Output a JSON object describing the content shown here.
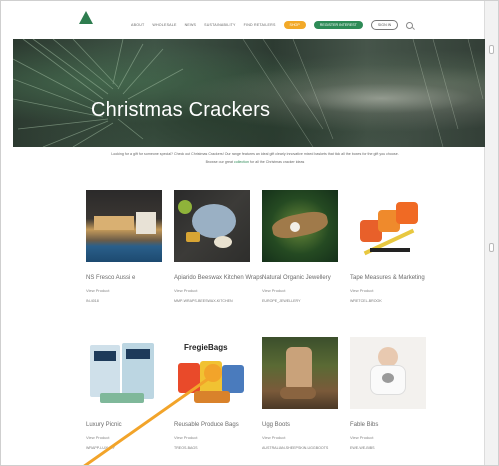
{
  "header": {
    "nav": [
      "About",
      "Wholesale",
      "News",
      "Sustainability",
      "Find Retailers"
    ],
    "pill_orange": "Shop",
    "pill_green": "Register Interest",
    "pill_outline": "Sign In"
  },
  "hero": {
    "title": "Christmas Crackers"
  },
  "intro": {
    "line1": "Looking for a gift for someone special? Check out Christmas Crackers! Our range features an ideal gift clearly innovative mixed baskets that tick all the boxes for the gift you choose.",
    "line2": "Browse our great",
    "link_text": "collection",
    "line2_tail": "for all the Christmas cracker ideas"
  },
  "products": [
    {
      "title": "NS Fresco Aussi e",
      "tag": "View Product",
      "ref": "IN-4018"
    },
    {
      "title": "Apiarido Beeswax Kitchen Wraps",
      "tag": "View Product",
      "ref": "MMP-WRAPS-BEESWAX-KITCHEN"
    },
    {
      "title": "Natural Organic Jewellery",
      "tag": "View Product",
      "ref": "EUROPE_JEWELLERY"
    },
    {
      "title": "Tape Measures & Marketing",
      "tag": "View Product",
      "ref": "WRETCEL-BROOK"
    },
    {
      "title": "Luxury Picnic",
      "tag": "View Product",
      "ref": "WRAPP-LUXURY"
    },
    {
      "title": "Reusable Produce Bags",
      "tag": "View Product",
      "ref": "TREOS-BAGS"
    },
    {
      "title": "Ugg Boots",
      "tag": "View Product",
      "ref": "AUSTRALIAN-SHEEPSKIN-UGGBOOTS"
    },
    {
      "title": "Fable Bibs",
      "tag": "View Product",
      "ref": "EWE-WE-BIBS"
    }
  ],
  "logos": {
    "fregie": "FregieBags"
  },
  "colors": {
    "accent_green": "#2e8b57",
    "accent_orange": "#f2a928",
    "arrow": "#f2a42a"
  }
}
